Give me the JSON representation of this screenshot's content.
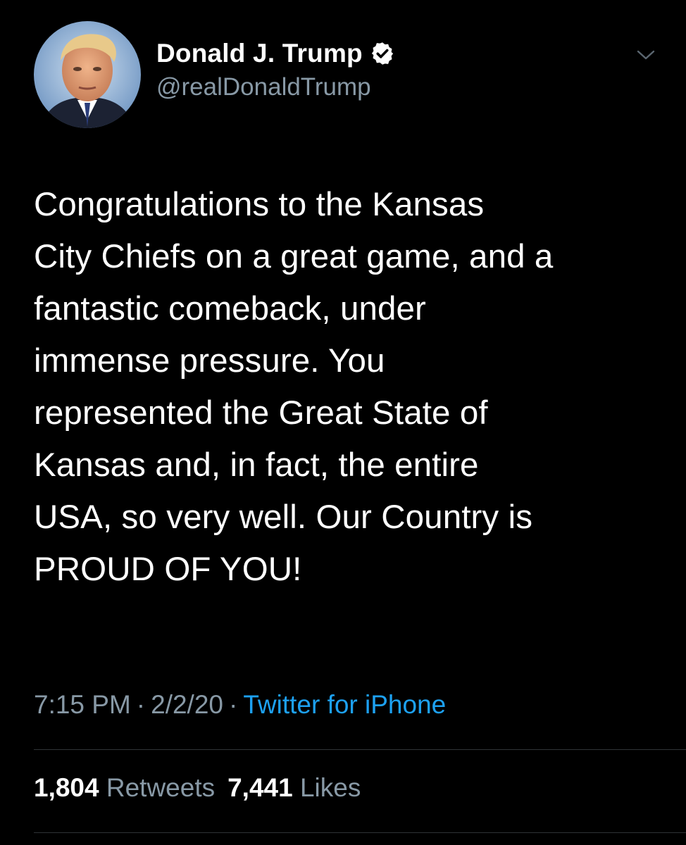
{
  "user": {
    "display_name": "Donald J. Trump",
    "handle": "@realDonaldTrump",
    "verified_icon": "verified-badge-icon"
  },
  "menu": {
    "icon": "chevron-down-icon"
  },
  "tweet": {
    "lines": [
      "Congratulations to the Kansas",
      "City Chiefs on a great game, and a",
      "fantastic comeback, under",
      "immense pressure. You",
      "represented the Great State of",
      "Kansas and, in fact, the entire",
      "USA, so very well. Our Country is",
      "PROUD OF YOU!"
    ],
    "time": "7:15 PM",
    "separator": "·",
    "date": "2/2/20",
    "source": "Twitter for iPhone"
  },
  "stats": {
    "retweets_count": "1,804",
    "retweets_label": "Retweets",
    "likes_count": "7,441",
    "likes_label": "Likes"
  },
  "colors": {
    "background": "#000000",
    "text": "#ffffff",
    "secondary": "#8899a6",
    "accent": "#1da1f2",
    "divider": "#2f3336"
  }
}
